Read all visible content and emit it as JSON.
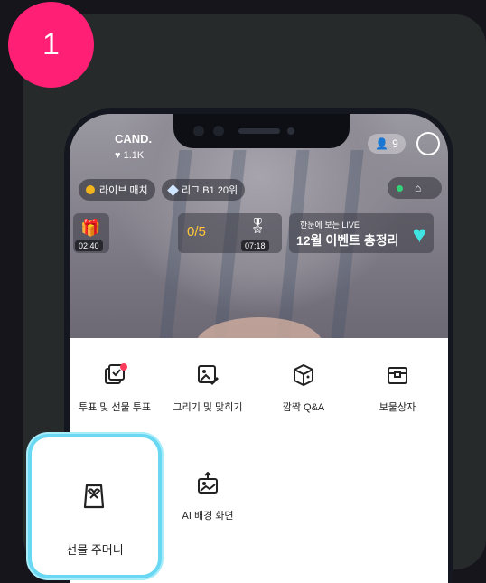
{
  "step_number": "1",
  "stream": {
    "streamer_name": "CAND.",
    "likes": "1.1K",
    "viewer_count": "9",
    "live_match_label": "라이브 매치",
    "league_label": "리그 B1 20위",
    "vote_counter": "0/5",
    "timer_left": "02:40",
    "timer_mid": "07:18",
    "live_small": "한눈에 보는 LIVE",
    "event_title": "12월 이벤트 총정리"
  },
  "menu": {
    "items": [
      {
        "label": "투표 및 선물 투표",
        "icon": "vote-box-icon"
      },
      {
        "label": "그리기 및 맞히기",
        "icon": "draw-picture-icon"
      },
      {
        "label": "깜짝 Q&A",
        "icon": "surprise-cube-icon"
      },
      {
        "label": "보물상자",
        "icon": "treasure-chest-icon"
      },
      {
        "label": "AI 배경 화면",
        "icon": "ai-background-icon"
      }
    ],
    "highlighted": {
      "label": "선물 주머니",
      "icon": "gift-pouch-icon"
    }
  },
  "colors": {
    "step_badge": "#ff1f74",
    "highlight_border": "#6ad8f3",
    "notification_dot": "#ff3b5c"
  }
}
